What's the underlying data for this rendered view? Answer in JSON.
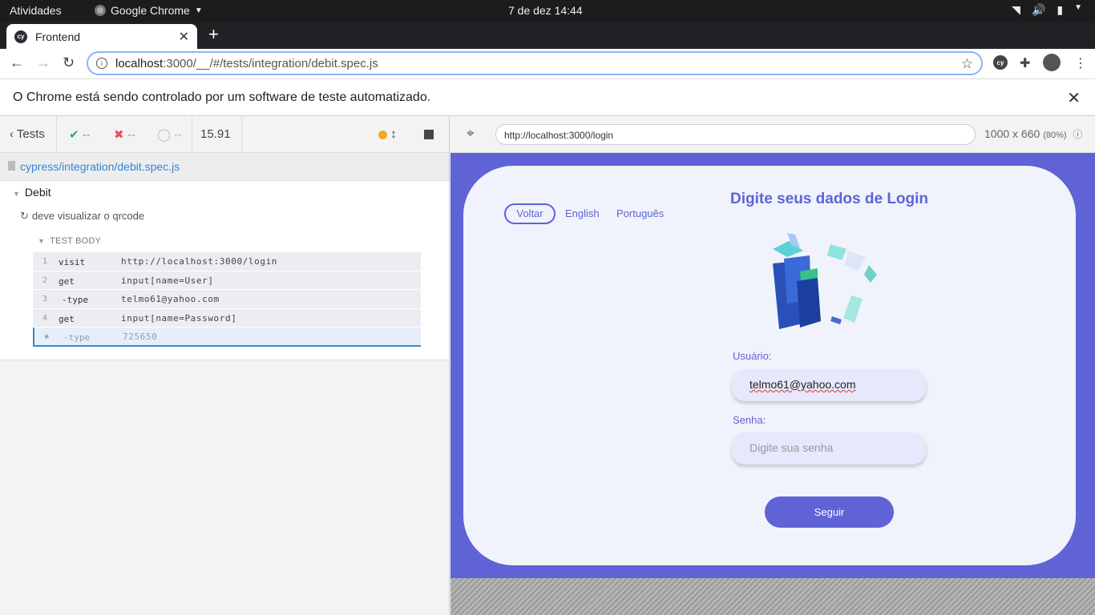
{
  "os": {
    "activities": "Atividades",
    "app_name": "Google Chrome",
    "clock": "7 de dez  14:44"
  },
  "browser": {
    "tab_title": "Frontend",
    "url_host": "localhost",
    "url_rest": ":3000/__/#/tests/integration/debit.spec.js",
    "infobar": "O Chrome está sendo controlado por um software de teste automatizado."
  },
  "cypress": {
    "tests_label": "Tests",
    "passed": "--",
    "failed": "--",
    "pending": "--",
    "duration": "15.91",
    "spec_path": "cypress/integration/debit.spec.js",
    "suite": "Debit",
    "test": "deve visualizar o qrcode",
    "section": "TEST BODY",
    "commands": [
      {
        "n": "1",
        "name": "visit",
        "msg": "http://localhost:3000/login"
      },
      {
        "n": "2",
        "name": "get",
        "msg": "input[name=User]"
      },
      {
        "n": "3",
        "name": "-type",
        "msg": "telmo61@yahoo.com"
      },
      {
        "n": "4",
        "name": "get",
        "msg": "input[name=Password]"
      },
      {
        "n": "",
        "name": "-type",
        "msg": "725650"
      }
    ],
    "aut_url": "http://localhost:3000/login",
    "viewport": "1000 x 660",
    "scale": "(80%)"
  },
  "app": {
    "back": "Voltar",
    "lang_en": "English",
    "lang_pt": "Português",
    "title": "Digite seus dados de Login",
    "user_label": "Usuário:",
    "user_value": "telmo61@yahoo.com",
    "password_label": "Senha:",
    "password_placeholder": "Digite sua senha",
    "submit": "Seguir"
  },
  "colors": {
    "accent": "#5f63d6",
    "cypress_link": "#3386d6",
    "dark_bar": "#1c1c1c"
  }
}
